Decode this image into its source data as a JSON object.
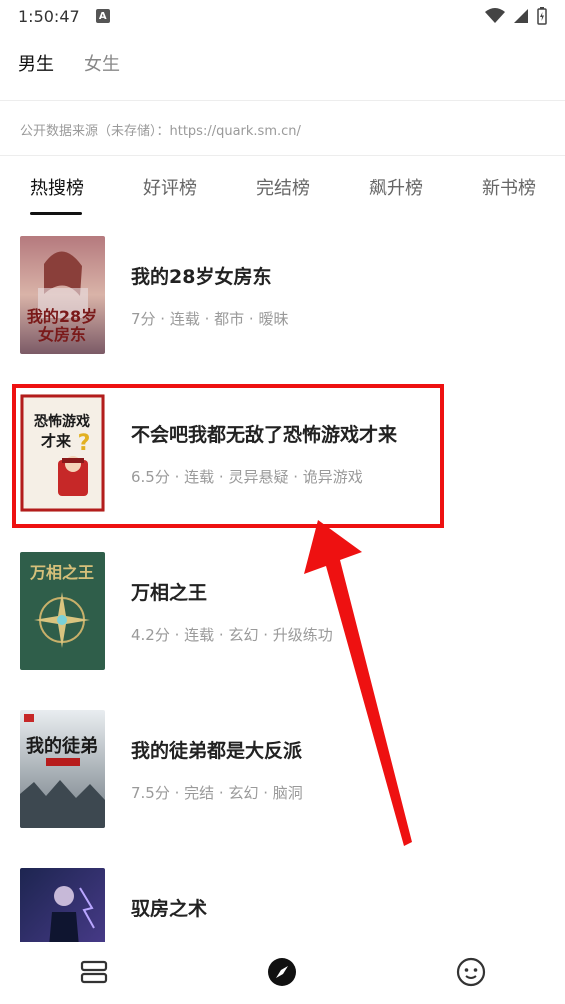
{
  "status_bar": {
    "time": "1:50:47",
    "badge": "A"
  },
  "gender_tabs": [
    {
      "label": "男生",
      "active": true
    },
    {
      "label": "女生",
      "active": false
    }
  ],
  "source_note": "公开数据来源（未存储）：https://quark.sm.cn/",
  "rank_tabs": [
    {
      "label": "热搜榜",
      "active": true
    },
    {
      "label": "好评榜",
      "active": false
    },
    {
      "label": "完结榜",
      "active": false
    },
    {
      "label": "飙升榜",
      "active": false
    },
    {
      "label": "新书榜",
      "active": false
    }
  ],
  "books": [
    {
      "title": "我的28岁女房东",
      "meta": "7分 · 连载 · 都市 · 暧昧",
      "cover_text": "我的28岁女房东"
    },
    {
      "title": "不会吧我都无敌了恐怖游戏才来",
      "meta": "6.5分 · 连载 · 灵异悬疑 · 诡异游戏",
      "cover_text": "恐怖游戏才来"
    },
    {
      "title": "万相之王",
      "meta": "4.2分 · 连载 · 玄幻 · 升级练功",
      "cover_text": "万相之王"
    },
    {
      "title": "我的徒弟都是大反派",
      "meta": "7.5分 · 完结 · 玄幻 · 脑洞",
      "cover_text": "我的徒弟"
    },
    {
      "title": "驭房之术",
      "meta": "",
      "cover_text": ""
    }
  ],
  "colors": {
    "highlight": "#ee1111",
    "active_text": "#111111",
    "muted": "#9a9a9a"
  },
  "icons": {
    "nav_left": "bookshelf-icon",
    "nav_center": "compass-icon",
    "nav_right": "smiley-icon"
  }
}
